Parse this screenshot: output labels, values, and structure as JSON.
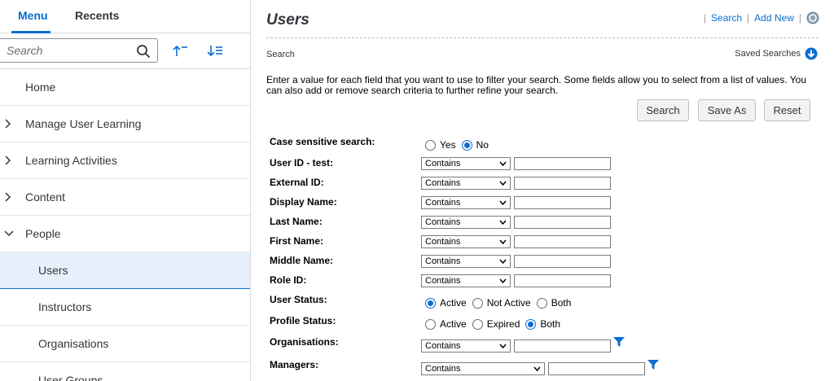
{
  "sidebar": {
    "tabs": [
      {
        "label": "Menu",
        "active": true
      },
      {
        "label": "Recents",
        "active": false
      }
    ],
    "search": {
      "placeholder": "Search",
      "value": ""
    },
    "nav": [
      {
        "label": "Home",
        "chevron": "none",
        "sub": false
      },
      {
        "label": "Manage User Learning",
        "chevron": "right",
        "sub": false
      },
      {
        "label": "Learning Activities",
        "chevron": "right",
        "sub": false
      },
      {
        "label": "Content",
        "chevron": "right",
        "sub": false
      },
      {
        "label": "People",
        "chevron": "down",
        "sub": false
      },
      {
        "label": "Users",
        "chevron": "none",
        "sub": true,
        "selected": true
      },
      {
        "label": "Instructors",
        "chevron": "none",
        "sub": true
      },
      {
        "label": "Organisations",
        "chevron": "none",
        "sub": true
      },
      {
        "label": "User Groups",
        "chevron": "none",
        "sub": true
      }
    ]
  },
  "main": {
    "title": "Users",
    "links": {
      "search": "Search",
      "add_new": "Add New"
    },
    "section_label": "Search",
    "saved_searches": "Saved Searches",
    "instructions": "Enter a value for each field that you want to use to filter your search. Some fields allow you to select from a list of values. You can also add or remove search criteria to further refine your search.",
    "buttons": {
      "search": "Search",
      "save_as": "Save As",
      "reset": "Reset"
    },
    "case_sensitive": {
      "label": "Case sensitive search:",
      "options": [
        "Yes",
        "No"
      ],
      "selected": "No"
    },
    "fields": [
      {
        "label": "User ID - test:",
        "operator": "Contains",
        "value": ""
      },
      {
        "label": "External ID:",
        "operator": "Contains",
        "value": ""
      },
      {
        "label": "Display Name:",
        "operator": "Contains",
        "value": ""
      },
      {
        "label": "Last Name:",
        "operator": "Contains",
        "value": ""
      },
      {
        "label": "First Name:",
        "operator": "Contains",
        "value": ""
      },
      {
        "label": "Middle Name:",
        "operator": "Contains",
        "value": ""
      },
      {
        "label": "Role ID:",
        "operator": "Contains",
        "value": ""
      }
    ],
    "user_status": {
      "label": "User Status:",
      "options": [
        "Active",
        "Not Active",
        "Both"
      ],
      "selected": "Active"
    },
    "profile_status": {
      "label": "Profile Status:",
      "options": [
        "Active",
        "Expired",
        "Both"
      ],
      "selected": "Both"
    },
    "organisations": {
      "label": "Organisations:",
      "operator": "Contains",
      "value": ""
    },
    "managers": {
      "label": "Managers:",
      "operator": "Contains",
      "value": ""
    }
  },
  "colors": {
    "accent": "#0a6ed1",
    "selected_bg": "#e5f0fa"
  }
}
